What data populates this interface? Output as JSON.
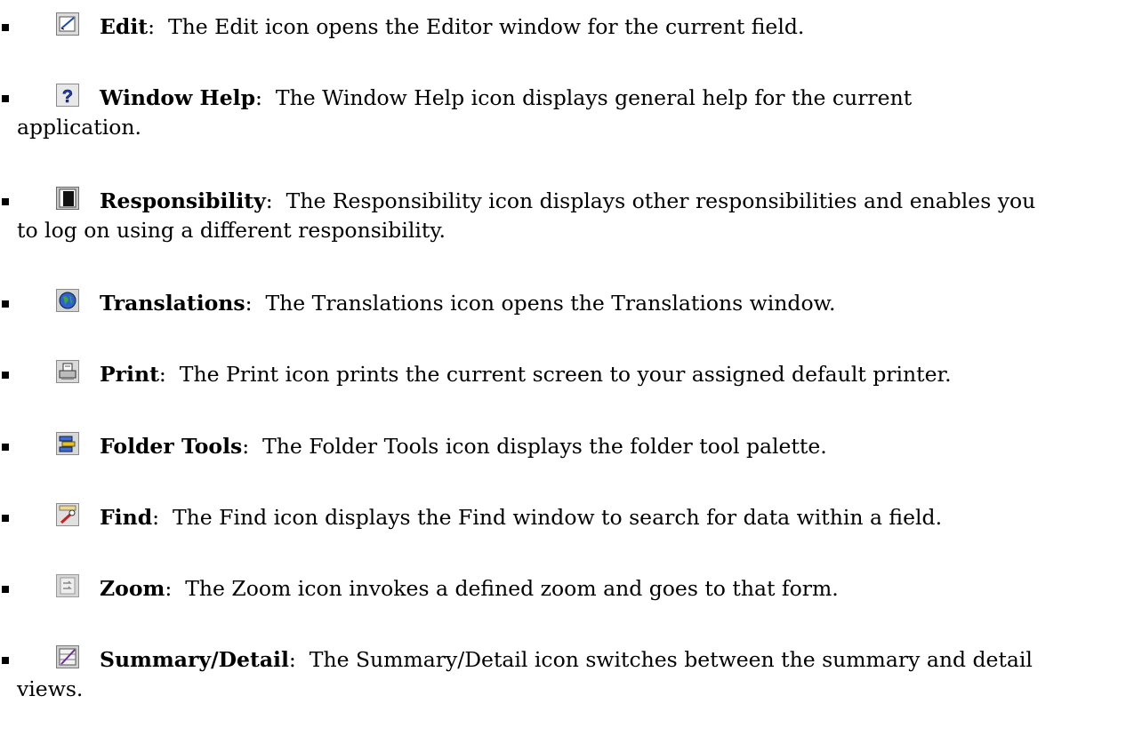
{
  "items": [
    {
      "icon": "edit-icon",
      "term": "Edit",
      "description": "The Edit icon opens the Editor window for the current field.",
      "continuation": ""
    },
    {
      "icon": "window-help-icon",
      "term": "Window Help",
      "description": "The Window Help icon displays general help for the current",
      "continuation": "application."
    },
    {
      "icon": "responsibility-icon",
      "term": "Responsibility",
      "description": "The Responsibility icon displays other responsibilities and enables you",
      "continuation": "to log on using a different responsibility."
    },
    {
      "icon": "translations-icon",
      "term": "Translations",
      "description": "The Translations icon opens the Translations window.",
      "continuation": ""
    },
    {
      "icon": "print-icon",
      "term": "Print",
      "description": "The Print icon prints the current screen to your assigned default printer.",
      "continuation": ""
    },
    {
      "icon": "folder-tools-icon",
      "term": "Folder Tools",
      "description": "The Folder Tools icon displays the folder tool palette.",
      "continuation": ""
    },
    {
      "icon": "find-icon",
      "term": "Find",
      "description": "The Find icon displays the Find window to search for data within a field.",
      "continuation": ""
    },
    {
      "icon": "zoom-icon",
      "term": "Zoom",
      "description": "The Zoom icon invokes a defined zoom and goes to that form.",
      "continuation": ""
    },
    {
      "icon": "summary-detail-icon",
      "term": "Summary/Detail",
      "description": "The Summary/Detail icon switches between the summary and detail",
      "continuation": "views."
    }
  ]
}
